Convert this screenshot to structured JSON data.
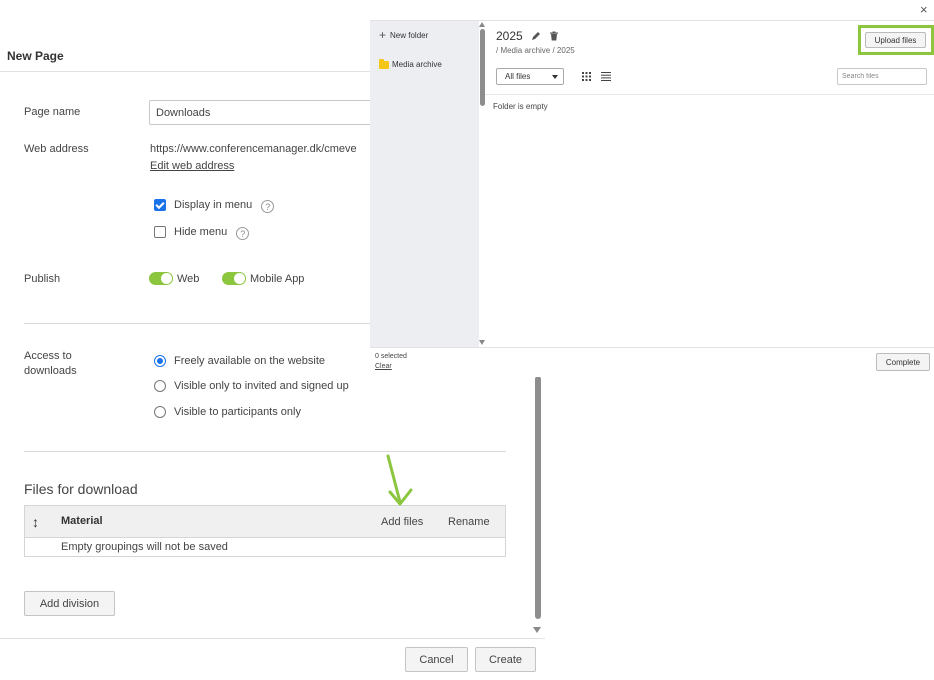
{
  "page": {
    "title": "New Page",
    "page_name_label": "Page name",
    "page_name_value": "Downloads",
    "web_address_label": "Web address",
    "web_address_value": "https://www.conferencemanager.dk/cmeve",
    "edit_web_address": "Edit web address",
    "display_in_menu": "Display in menu",
    "display_in_menu_checked": true,
    "hide_menu": "Hide menu",
    "hide_menu_checked": false,
    "help_glyph": "?",
    "publish_label": "Publish",
    "publish_web": "Web",
    "publish_mobile": "Mobile App",
    "access_label": "Access to downloads",
    "access_options": [
      {
        "label": "Freely available on the website",
        "selected": true
      },
      {
        "label": "Visible only to invited and signed up",
        "selected": false
      },
      {
        "label": "Visible to participants only",
        "selected": false
      }
    ],
    "files_title": "Files for download",
    "files_table": {
      "material": "Material",
      "add_files": "Add files",
      "rename": "Rename",
      "empty_note": "Empty groupings will not be saved"
    },
    "add_division": "Add division",
    "cancel": "Cancel",
    "create": "Create"
  },
  "dialog": {
    "close_glyph": "×",
    "new_folder": "New folder",
    "media_archive": "Media archive",
    "folder_title": "2025",
    "breadcrumb": "/ Media archive / 2025",
    "upload_files": "Upload files",
    "filter_value": "All files",
    "search_placeholder": "Search files",
    "empty_message": "Folder is empty",
    "selected_count": "0 selected",
    "clear": "Clear",
    "complete": "Complete"
  },
  "colors": {
    "accent_green": "#8cc63f",
    "checkbox_blue": "#1a73e8",
    "folder_yellow": "#f5c518",
    "tree_bg": "#edeef2"
  }
}
